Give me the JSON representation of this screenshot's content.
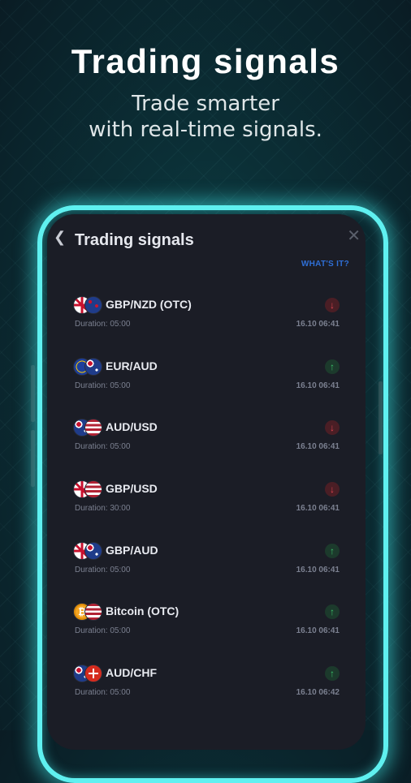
{
  "hero": {
    "title": "Trading signals",
    "subtitle_line1": "Trade smarter",
    "subtitle_line2": "with real-time signals."
  },
  "screen": {
    "title": "Trading signals",
    "back_icon": "chevron-left-icon",
    "close_icon": "close-icon",
    "whats_it_label": "WHAT'S IT?"
  },
  "signals": [
    {
      "pair": "GBP/NZD (OTC)",
      "duration": "Duration: 05:00",
      "time": "16.10 06:41",
      "direction": "down",
      "flags": [
        "gb",
        "nz"
      ]
    },
    {
      "pair": "EUR/AUD",
      "duration": "Duration: 05:00",
      "time": "16.10 06:41",
      "direction": "up",
      "flags": [
        "eu",
        "au"
      ]
    },
    {
      "pair": "AUD/USD",
      "duration": "Duration: 05:00",
      "time": "16.10 06:41",
      "direction": "down",
      "flags": [
        "au",
        "us"
      ]
    },
    {
      "pair": "GBP/USD",
      "duration": "Duration: 30:00",
      "time": "16.10 06:41",
      "direction": "down",
      "flags": [
        "gb",
        "us"
      ]
    },
    {
      "pair": "GBP/AUD",
      "duration": "Duration: 05:00",
      "time": "16.10 06:41",
      "direction": "up",
      "flags": [
        "gb",
        "au"
      ]
    },
    {
      "pair": "Bitcoin (OTC)",
      "duration": "Duration: 05:00",
      "time": "16.10 06:41",
      "direction": "up",
      "flags": [
        "btc",
        "us"
      ]
    },
    {
      "pair": "AUD/CHF",
      "duration": "Duration: 05:00",
      "time": "16.10 06:42",
      "direction": "up",
      "flags": [
        "au",
        "ch"
      ]
    }
  ],
  "colors": {
    "accent_glow": "#5ff0f0",
    "down": "#e0454f",
    "up": "#3bbf6a",
    "link": "#2f6fd6"
  }
}
